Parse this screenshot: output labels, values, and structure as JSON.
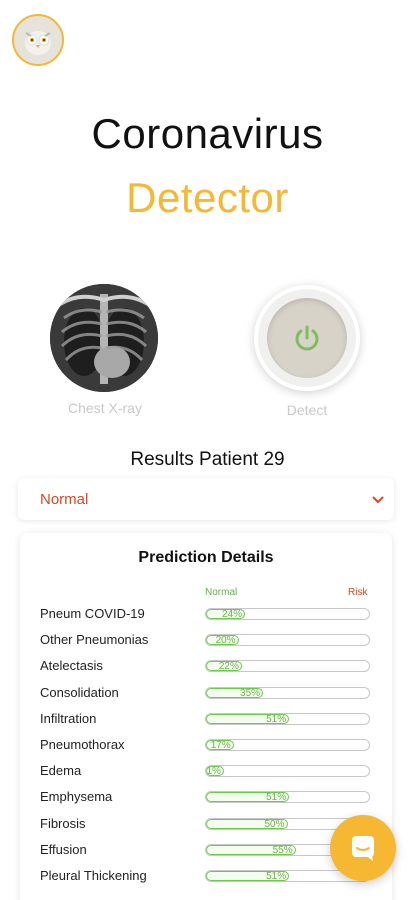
{
  "header": {
    "avatar_icon": "owl-avatar-icon",
    "title_line1": "Coronavirus",
    "title_line2": "Detector"
  },
  "colors": {
    "accent": "#f6b733",
    "alert": "#e0451f",
    "normal": "#63b04a"
  },
  "actions": {
    "xray_label": "Chest X-ray",
    "detect_label": "Detect",
    "detect_icon": "power-icon"
  },
  "results": {
    "title": "Results Patient 29",
    "selected": "Normal"
  },
  "details": {
    "title": "Prediction Details",
    "legend_normal": "Normal",
    "legend_risk": "Risk",
    "items": [
      {
        "label": "Pneum COVID-19",
        "percent": 24,
        "percent_text": "24%"
      },
      {
        "label": "Other Pneumonias",
        "percent": 20,
        "percent_text": "20%"
      },
      {
        "label": "Atelectasis",
        "percent": 22,
        "percent_text": "22%"
      },
      {
        "label": "Consolidation",
        "percent": 35,
        "percent_text": "35%"
      },
      {
        "label": "Infiltration",
        "percent": 51,
        "percent_text": "51%"
      },
      {
        "label": "Pneumothorax",
        "percent": 17,
        "percent_text": "17%"
      },
      {
        "label": "Edema",
        "percent": 11,
        "percent_text": "11%"
      },
      {
        "label": "Emphysema",
        "percent": 51,
        "percent_text": "51%"
      },
      {
        "label": "Fibrosis",
        "percent": 50,
        "percent_text": "50%"
      },
      {
        "label": "Effusion",
        "percent": 55,
        "percent_text": "55%"
      },
      {
        "label": "Pleural Thickening",
        "percent": 51,
        "percent_text": "51%"
      }
    ]
  },
  "chat": {
    "icon": "chat-icon"
  }
}
